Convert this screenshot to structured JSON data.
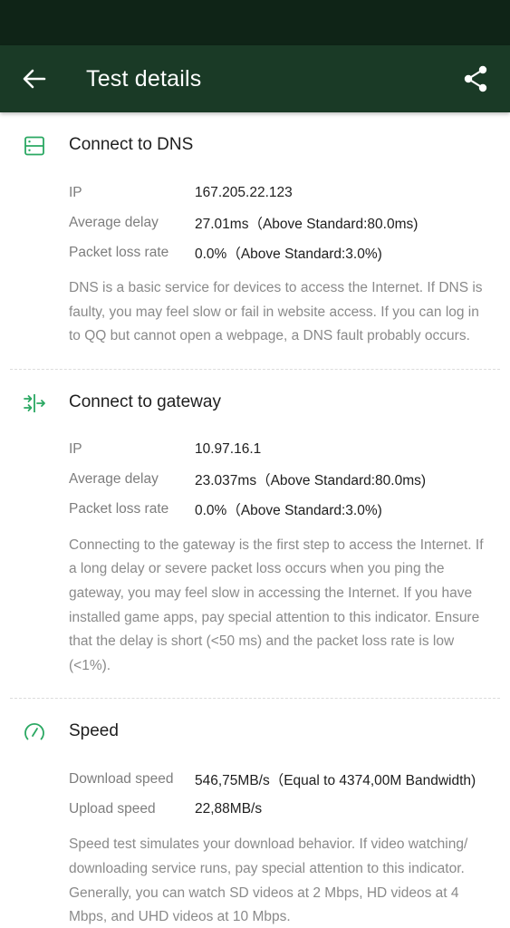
{
  "header": {
    "title": "Test details",
    "back_icon": "arrow-left-icon",
    "share_icon": "share-icon"
  },
  "colors": {
    "status_bar": "#0f2417",
    "app_bar": "#1a3a26",
    "accent": "#2aa862"
  },
  "sections": [
    {
      "title": "Connect to DNS",
      "icon": "server-icon",
      "rows": [
        {
          "label": "IP",
          "value": "167.205.22.123"
        },
        {
          "label": "Average delay",
          "value": "27.01ms（Above Standard:80.0ms)"
        },
        {
          "label": "Packet loss rate",
          "value": "0.0%（Above Standard:3.0%)"
        }
      ],
      "description": "DNS is a basic service for devices to access the Internet. If DNS is faulty, you may feel slow or fail in website access. If you can log in to QQ but cannot open a webpage, a DNS fault probably occurs."
    },
    {
      "title": "Connect to gateway",
      "icon": "gateway-icon",
      "rows": [
        {
          "label": "IP",
          "value": "10.97.16.1"
        },
        {
          "label": "Average delay",
          "value": "23.037ms（Above Standard:80.0ms)"
        },
        {
          "label": "Packet loss rate",
          "value": "0.0%（Above Standard:3.0%)"
        }
      ],
      "description": "Connecting to the gateway is the first step to access the Internet. If a long delay or severe packet loss occurs when you ping the gateway, you may feel slow in accessing the Internet. If you have installed game apps, pay special attention to this indicator. Ensure that the delay is short (<50 ms) and the packet loss rate is low (<1%)."
    },
    {
      "title": "Speed",
      "icon": "speedometer-icon",
      "rows": [
        {
          "label": "Download speed",
          "value": "546,75MB/s（Equal to 4374,00M Bandwidth)"
        },
        {
          "label": "Upload speed",
          "value": "22,88MB/s"
        }
      ],
      "description": "Speed test simulates your download behavior. If video watching/ downloading service runs, pay special attention to this indicator. Generally, you can watch SD videos at 2 Mbps, HD videos at 4 Mbps, and UHD videos at 10 Mbps."
    }
  ]
}
